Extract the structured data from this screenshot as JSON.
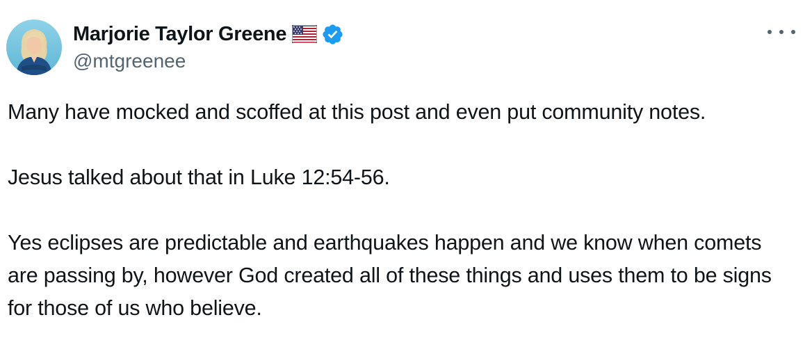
{
  "author": {
    "display_name": "Marjorie Taylor Greene",
    "handle": "@mtgreenee",
    "flag_icon": "us-flag-icon",
    "verified_icon": "verified-badge-icon",
    "verified_color": "#1d9bf0"
  },
  "menu": {
    "icon": "more-options-icon"
  },
  "tweet": {
    "paragraphs": [
      "Many have mocked and scoffed at this post and even put community notes.",
      "Jesus talked about that in Luke 12:54-56.",
      "Yes eclipses are predictable and earthquakes happen and we know when comets are passing by, however God created all of these things and uses them to be signs for those of us who believe."
    ]
  },
  "colors": {
    "text": "#0f1419",
    "secondary": "#536471",
    "accent": "#1d9bf0"
  }
}
